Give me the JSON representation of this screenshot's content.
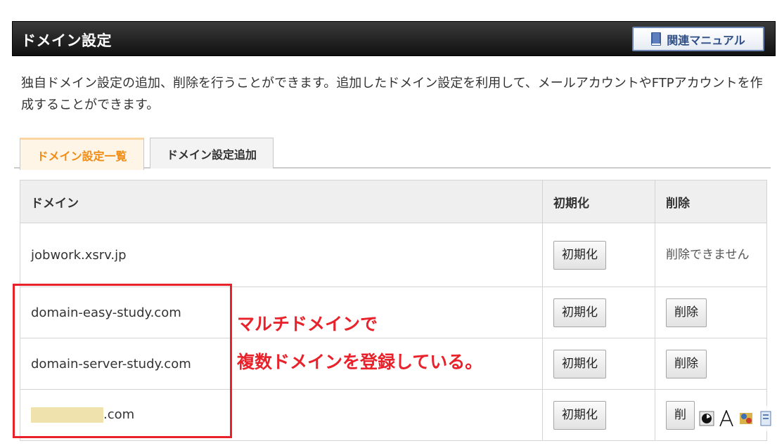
{
  "header": {
    "title": "ドメイン設定",
    "manual_button": "関連マニュアル",
    "accent": "#6b86b5"
  },
  "description": "独自ドメイン設定の追加、削除を行うことができます。追加したドメイン設定を利用して、メールアカウントやFTPアカウントを作成することができます。",
  "tabs": [
    {
      "label": "ドメイン設定一覧",
      "active": true
    },
    {
      "label": "ドメイン設定追加",
      "active": false
    }
  ],
  "table": {
    "columns": [
      "ドメイン",
      "初期化",
      "削除"
    ],
    "rows": [
      {
        "domain": "jobwork.xsrv.jp",
        "init_label": "初期化",
        "delete_label": "削除できません",
        "deletable": false
      },
      {
        "domain": "domain-easy-study.com",
        "init_label": "初期化",
        "delete_label": "削除",
        "deletable": true
      },
      {
        "domain": "domain-server-study.com",
        "init_label": "初期化",
        "delete_label": "削除",
        "deletable": true
      },
      {
        "domain": ".com",
        "masked_prefix": true,
        "init_label": "初期化",
        "delete_label": "削",
        "deletable": true
      }
    ]
  },
  "annotation": {
    "line1": "マルチドメインで",
    "line2": "複数ドメインを登録している。",
    "color": "#e8212a"
  },
  "tray_icons": [
    "clock-icon",
    "font-icon",
    "app-icon",
    "file-icon"
  ]
}
